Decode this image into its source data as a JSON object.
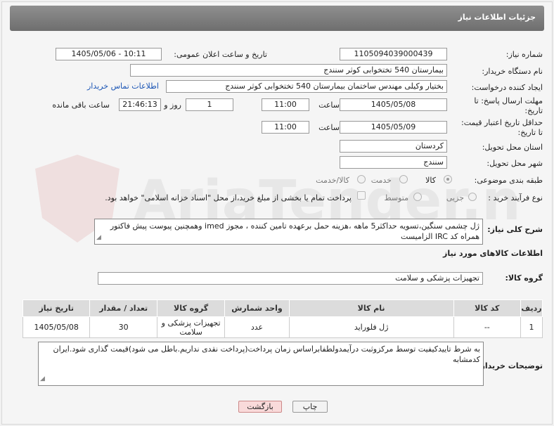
{
  "header": {
    "title": "جزئیات اطلاعات نیاز"
  },
  "form": {
    "need_number_label": "شماره نیاز:",
    "need_number": "1105094039000439",
    "announce_label": "تاریخ و ساعت اعلان عمومی:",
    "announce_value": "1405/05/06 - 10:11",
    "buyer_org_label": "نام دستگاه خریدار:",
    "buyer_org": "بیمارستان 540 تختخوابی کوثر سنندج",
    "creator_label": "ایجاد کننده درخواست:",
    "creator": "بختیار وکیلی مهندس ساختمان بیمارستان 540 تختخوابی کوثر سنندج",
    "contact_link": "اطلاعات تماس خریدار",
    "deadline_label_1": "مهلت ارسال پاسخ: تا",
    "deadline_label_2": "تاریخ:",
    "deadline_date": "1405/05/08",
    "hour_label": "ساعت",
    "deadline_time": "11:00",
    "days_value": "1",
    "days_label": "روز و",
    "remaining_time": "21:46:13",
    "remaining_label": "ساعت باقی مانده",
    "validity_label_1": "حداقل تاریخ اعتبار قیمت:",
    "validity_label_2": "تا تاریخ:",
    "validity_date": "1405/05/09",
    "validity_time": "11:00",
    "province_label": "استان محل تحویل:",
    "province": "کردستان",
    "city_label": "شهر محل تحویل:",
    "city": "سنندج",
    "category_label": "طبقه بندی موضوعی:",
    "category_options": [
      "کالا",
      "خدمت",
      "کالا/خدمت"
    ],
    "process_label": "نوع فرآیند خرید :",
    "process_options": [
      "جزیی",
      "متوسط"
    ],
    "payment_note": "پرداخت تمام یا بخشی از مبلغ خرید،از محل \"اسناد خزانه اسلامی\" خواهد بود.",
    "summary_label": "شرح کلی نیاز:",
    "summary": "ژل چشمی سنگین،تسویه حداکثر5 ماهه ،هزینه حمل برعهده تامین کننده ، مجوز imed وهمچنین پیوست پیش فاکتور همراه کد IRC  الزامیست"
  },
  "goods": {
    "section_title": "اطلاعات کالاهای مورد نیاز",
    "group_label": "گروه کالا:",
    "group_value": "تجهیزات پزشکی و سلامت",
    "columns": [
      "ردیف",
      "کد کالا",
      "نام کالا",
      "واحد شمارش",
      "گروه کالا",
      "تعداد / مقدار",
      "تاریخ نیاز"
    ],
    "rows": [
      {
        "row": "1",
        "code": "--",
        "name": "ژل فلوراید",
        "unit": "عدد",
        "group": "تجهیزات پزشکی و سلامت",
        "qty": "30",
        "date": "1405/05/08"
      }
    ]
  },
  "buyer_notes": {
    "label": "توضیحات خریدار:",
    "text": "به شرط تاییدکیفیت توسط مرکزوثبت درآیمدولطفابراساس زمان پرداخت(پرداخت نقدی نداریم.باطل می شود)قیمت گذاری شود.ایران کدمشابه"
  },
  "buttons": {
    "print": "چاپ",
    "back": "بازگشت"
  },
  "watermark": {
    "text": "AriaTender.net"
  }
}
